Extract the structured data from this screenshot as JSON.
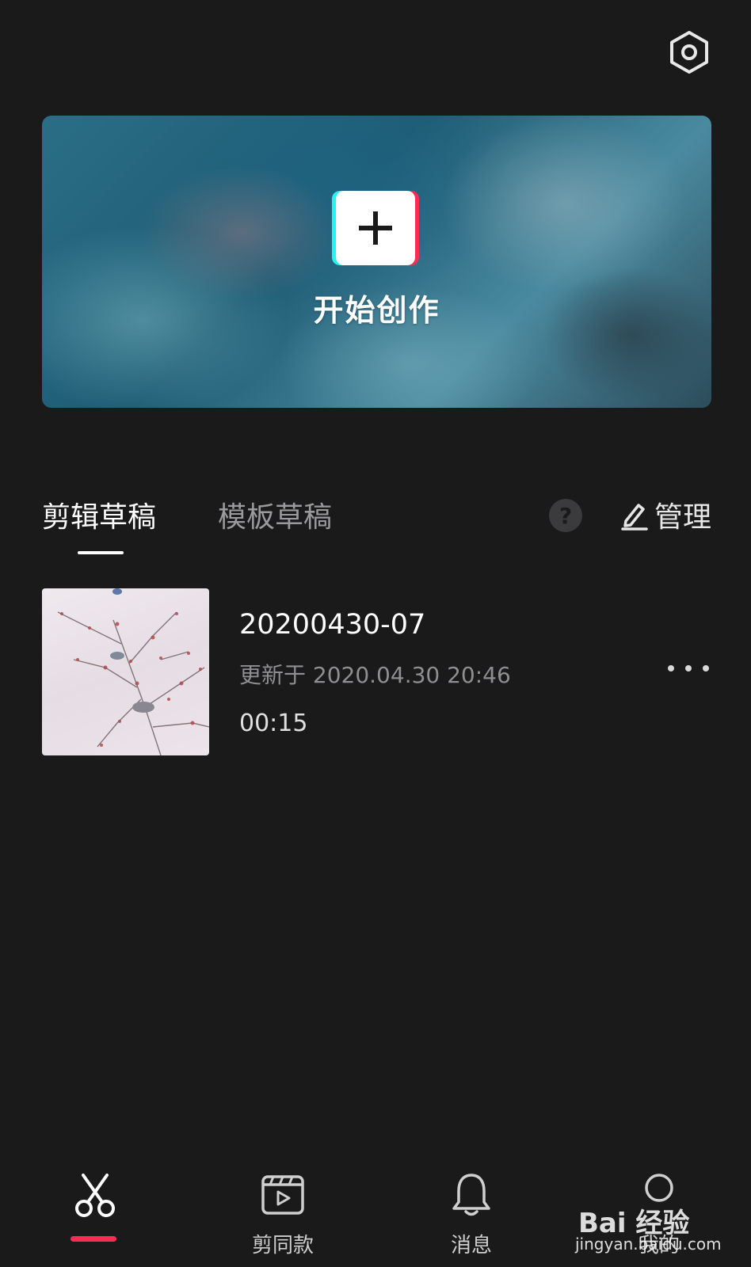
{
  "header": {
    "settings_icon": "settings-hexagon-icon"
  },
  "hero": {
    "title": "开始创作",
    "plus_icon": "plus-icon",
    "accent_cyan": "#25f4ee",
    "accent_red": "#fe2c55"
  },
  "tabs": [
    {
      "label": "剪辑草稿",
      "active": true
    },
    {
      "label": "模板草稿",
      "active": false
    }
  ],
  "help_label": "?",
  "manage": {
    "label": "管理",
    "icon": "edit-pencil-icon"
  },
  "drafts": [
    {
      "name": "20200430-07",
      "updated": "更新于 2020.04.30 20:46",
      "duration": "00:15"
    }
  ],
  "bottom_nav": [
    {
      "label": "",
      "icon": "scissors-icon",
      "active": true
    },
    {
      "label": "剪同款",
      "icon": "video-template-icon",
      "active": false
    },
    {
      "label": "消息",
      "icon": "bell-icon",
      "active": false
    },
    {
      "label": "我的",
      "icon": "profile-icon",
      "active": false
    }
  ],
  "watermark": {
    "logo": "Bai 经验",
    "url": "jingyan.baidu.com"
  }
}
